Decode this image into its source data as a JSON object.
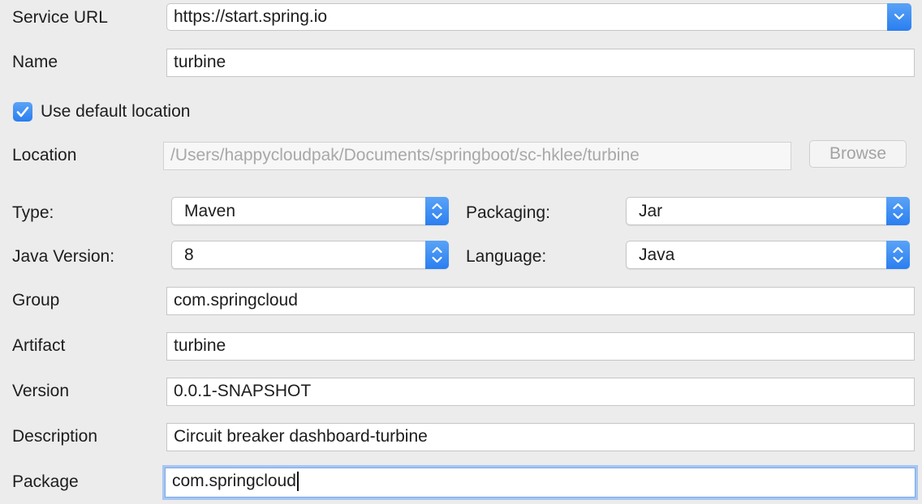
{
  "service_url": {
    "label": "Service URL",
    "value": "https://start.spring.io"
  },
  "name": {
    "label": "Name",
    "value": "turbine"
  },
  "use_default_location": {
    "label": "Use default location",
    "checked": true
  },
  "location": {
    "label": "Location",
    "value": "/Users/happycloudpak/Documents/springboot/sc-hklee/turbine",
    "browse_label": "Browse"
  },
  "type": {
    "label": "Type:",
    "value": "Maven"
  },
  "packaging": {
    "label": "Packaging:",
    "value": "Jar"
  },
  "java_version": {
    "label": "Java Version:",
    "value": "8"
  },
  "language": {
    "label": "Language:",
    "value": "Java"
  },
  "group": {
    "label": "Group",
    "value": "com.springcloud"
  },
  "artifact": {
    "label": "Artifact",
    "value": "turbine"
  },
  "version": {
    "label": "Version",
    "value": "0.0.1-SNAPSHOT"
  },
  "description": {
    "label": "Description",
    "value": "Circuit breaker dashboard-turbine"
  },
  "package": {
    "label": "Package",
    "value": "com.springcloud"
  },
  "colors": {
    "accent": "#2a7ef0",
    "background": "#ececec",
    "focus_ring": "#a7c6f2"
  },
  "icons": {
    "combo_arrow": "chevron-down-icon",
    "popup_arrow": "up-down-chevron-icon",
    "checkbox": "checkmark-icon"
  }
}
